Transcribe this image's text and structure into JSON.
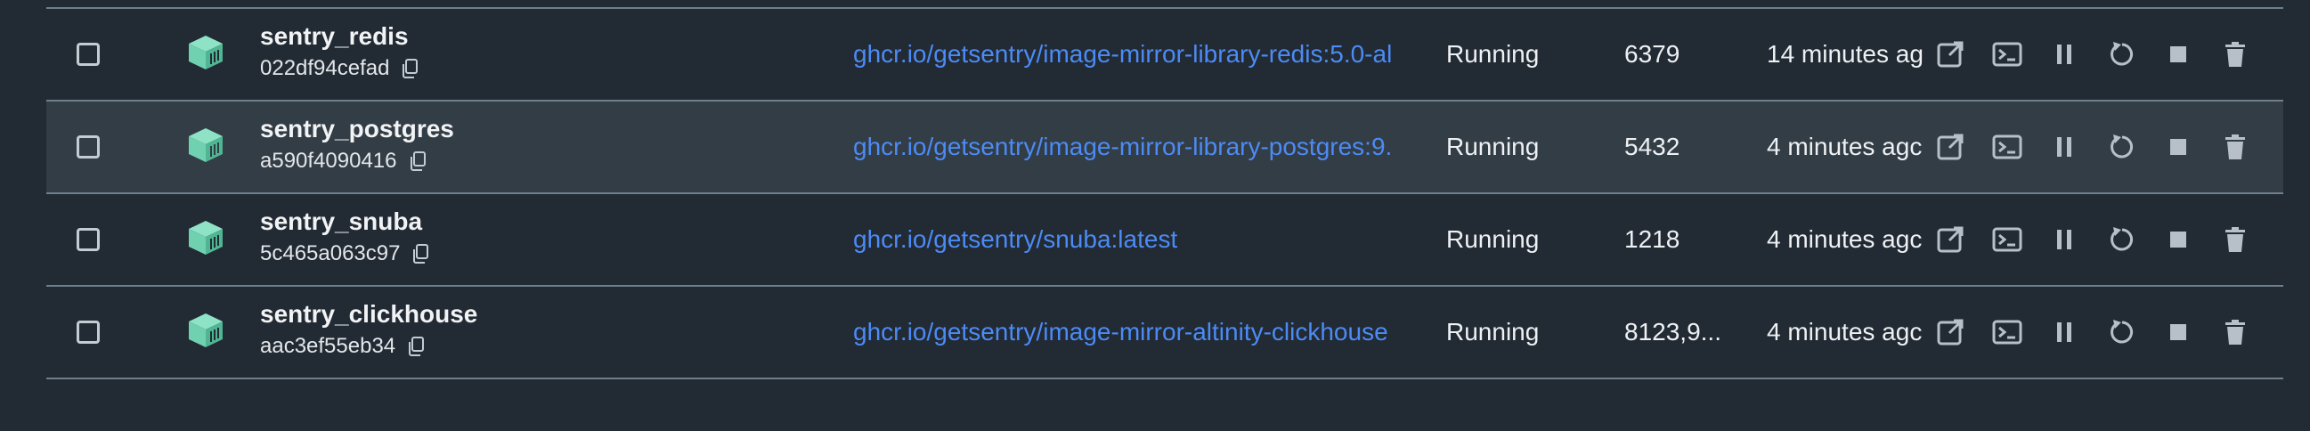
{
  "containers": [
    {
      "name": "sentry_redis",
      "id": "022df94cefad",
      "image": "ghcr.io/getsentry/image-mirror-library-redis:5.0-al",
      "status": "Running",
      "port": "6379",
      "started": "14 minutes ag"
    },
    {
      "name": "sentry_postgres",
      "id": "a590f4090416",
      "image": "ghcr.io/getsentry/image-mirror-library-postgres:9.",
      "status": "Running",
      "port": "5432",
      "started": "4 minutes agc"
    },
    {
      "name": "sentry_snuba",
      "id": "5c465a063c97",
      "image": "ghcr.io/getsentry/snuba:latest",
      "status": "Running",
      "port": "1218",
      "started": "4 minutes agc"
    },
    {
      "name": "sentry_clickhouse",
      "id": "aac3ef55eb34",
      "image": "ghcr.io/getsentry/image-mirror-altinity-clickhouse",
      "status": "Running",
      "port": "8123,9...",
      "started": "4 minutes agc"
    }
  ],
  "colors": {
    "accent": "#4c8bf5",
    "cube": "#6fd1b0",
    "background": "#222a33",
    "hover_row": "#333d46",
    "divider": "#6f7f8d"
  },
  "icons": [
    "open-in-browser-icon",
    "terminal-icon",
    "pause-icon",
    "restart-icon",
    "stop-icon",
    "delete-icon"
  ]
}
